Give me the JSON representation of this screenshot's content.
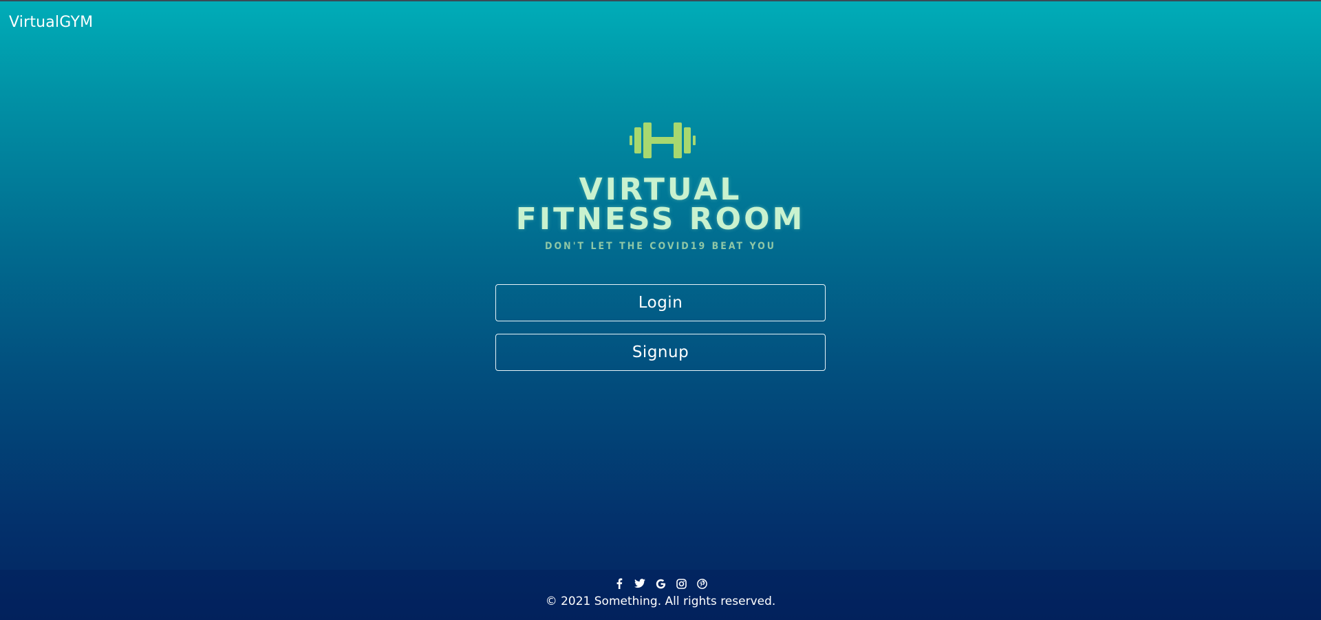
{
  "header": {
    "brand": "VirtualGYM"
  },
  "logo": {
    "line1": "VIRTUAL",
    "line2": "FITNESS ROOM",
    "tagline": "DON'T LET THE COVID19 BEAT YOU",
    "icon": "dumbbell-icon",
    "color": "#c9f2cf",
    "icon_color": "#a8d86f"
  },
  "actions": {
    "login_label": "Login",
    "signup_label": "Signup"
  },
  "footer": {
    "socials": [
      "facebook-icon",
      "twitter-icon",
      "google-icon",
      "instagram-icon",
      "pinterest-icon"
    ],
    "copyright": "© 2021 Something. All rights reserved."
  },
  "colors": {
    "gradient_top": "#00adb8",
    "gradient_bottom": "#03245f",
    "text": "#ffffff"
  }
}
